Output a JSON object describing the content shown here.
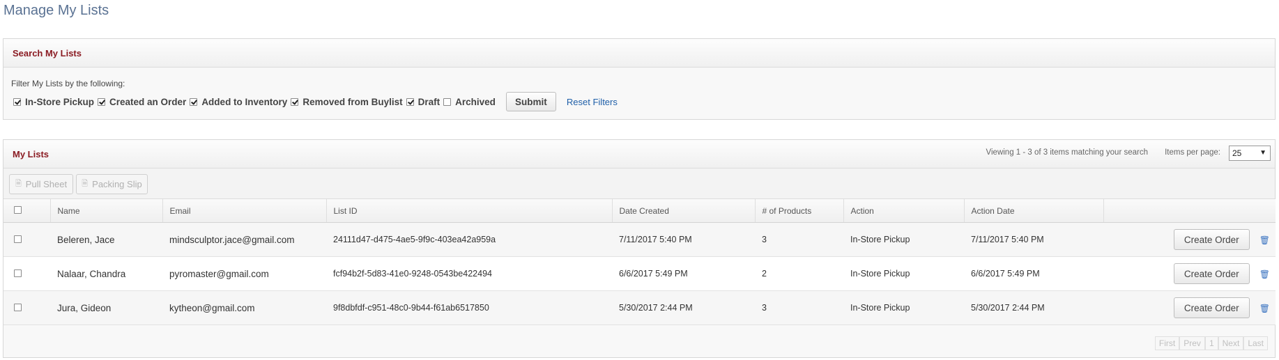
{
  "page": {
    "title": "Manage My Lists"
  },
  "search": {
    "title": "Search My Lists",
    "filter_label": "Filter My Lists by the following:",
    "filters": [
      {
        "label": "In-Store Pickup",
        "checked": true
      },
      {
        "label": "Created an Order",
        "checked": true
      },
      {
        "label": "Added to Inventory",
        "checked": true
      },
      {
        "label": "Removed from Buylist",
        "checked": true
      },
      {
        "label": "Draft",
        "checked": true
      },
      {
        "label": "Archived",
        "checked": false
      }
    ],
    "submit_label": "Submit",
    "reset_label": "Reset Filters"
  },
  "lists": {
    "title": "My Lists",
    "viewing": "Viewing 1 - 3 of 3 items matching your search",
    "items_per_page_label": "Items per page:",
    "items_per_page": "25",
    "toolbar": {
      "pull_sheet": "Pull Sheet",
      "packing_slip": "Packing Slip"
    },
    "columns": [
      "Name",
      "Email",
      "List ID",
      "Date Created",
      "# of Products",
      "Action",
      "Action Date"
    ],
    "rows": [
      {
        "name": "Beleren, Jace",
        "email": "mindsculptor.jace@gmail.com",
        "list_id": "24111d47-d475-4ae5-9f9c-403ea42a959a",
        "date_created": "7/11/2017 5:40 PM",
        "products": "3",
        "action": "In-Store Pickup",
        "action_date": "7/11/2017 5:40 PM"
      },
      {
        "name": "Nalaar, Chandra",
        "email": "pyromaster@gmail.com",
        "list_id": "fcf94b2f-5d83-41e0-9248-0543be422494",
        "date_created": "6/6/2017 5:49 PM",
        "products": "2",
        "action": "In-Store Pickup",
        "action_date": "6/6/2017 5:49 PM"
      },
      {
        "name": "Jura, Gideon",
        "email": "kytheon@gmail.com",
        "list_id": "9f8dbfdf-c951-48c0-9b44-f61ab6517850",
        "date_created": "5/30/2017 2:44 PM",
        "products": "3",
        "action": "In-Store Pickup",
        "action_date": "5/30/2017 2:44 PM"
      }
    ],
    "row_button_label": "Create Order",
    "pager": {
      "first": "First",
      "prev": "Prev",
      "page": "1",
      "next": "Next",
      "last": "Last"
    }
  }
}
